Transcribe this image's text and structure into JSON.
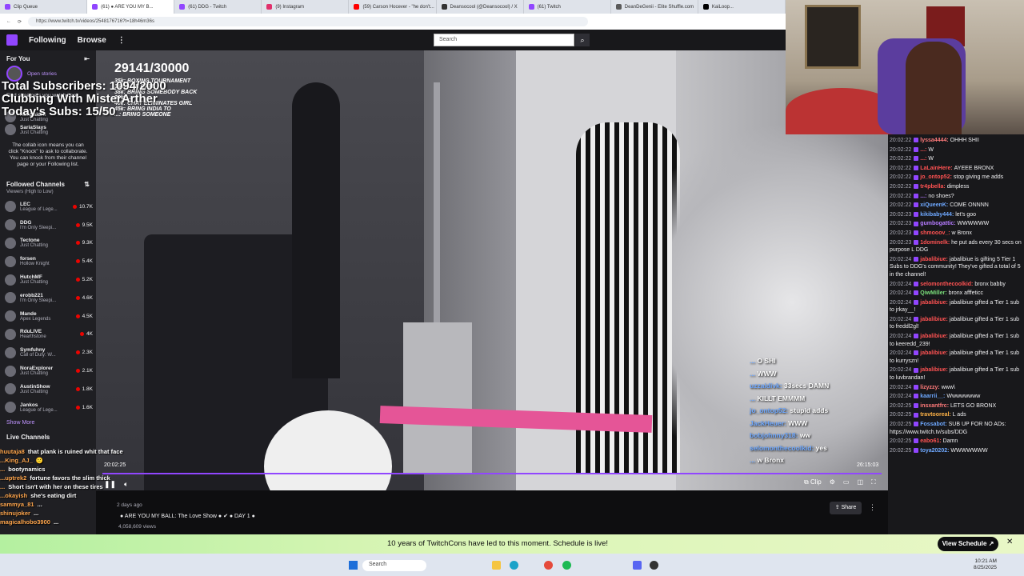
{
  "browser": {
    "tabs": [
      {
        "label": "Clip Queue",
        "color": "#9146ff"
      },
      {
        "label": "(61) ● ARE YOU MY B...",
        "color": "#9146ff"
      },
      {
        "label": "(61) DDG - Twitch",
        "color": "#9146ff"
      },
      {
        "label": "(9) Instagram",
        "color": "#e1306c"
      },
      {
        "label": "(59) Carson Hocever - \"he don't...",
        "color": "#ff0000"
      },
      {
        "label": "Deansocool (@Deansocool) / X",
        "color": "#333333"
      },
      {
        "label": "(61) Twitch",
        "color": "#9146ff"
      },
      {
        "label": "DeanDeGenii - Elite Shuffle.com",
        "color": "#5a5a5a"
      },
      {
        "label": "KaiLoop...",
        "color": "#000000"
      }
    ],
    "url": "https://www.twitch.tv/videos/2548176716?t=18h46m36s"
  },
  "nav": {
    "following": "Following",
    "browse": "Browse",
    "more": "⋮",
    "search_placeholder": "Search"
  },
  "sidebar": {
    "for_you": "For You",
    "open_stories": "Open stories",
    "find_streamers": "Find streamers you watch here",
    "suggested": [
      {
        "name": "AshSaidHi",
        "game": "Just Chatting"
      },
      {
        "name": "SariaSlays",
        "game": "Just Chatting"
      }
    ],
    "collab_tip": "The collab icon means you can click \"Knock\" to ask to collaborate. You can knock from their channel page or your Following list.",
    "followed_header": "Followed Channels",
    "followed_sub": "Viewers (High to Low)",
    "channels": [
      {
        "name": "LEC",
        "game": "League of Lege...",
        "viewers": "10.7K"
      },
      {
        "name": "DDG",
        "game": "I'm Only Sleepi...",
        "viewers": "9.5K"
      },
      {
        "name": "Tectone",
        "game": "Just Chatting",
        "viewers": "9.3K"
      },
      {
        "name": "forsen",
        "game": "Hollow Knight",
        "viewers": "5.4K"
      },
      {
        "name": "HutchMF",
        "game": "Just Chatting",
        "viewers": "5.2K"
      },
      {
        "name": "erobb221",
        "game": "I'm Only Sleepi...",
        "viewers": "4.6K"
      },
      {
        "name": "Mande",
        "game": "Apex Legends",
        "viewers": "4.5K"
      },
      {
        "name": "RduLIVE",
        "game": "Hearthstone",
        "viewers": "4K"
      },
      {
        "name": "Symfuhny",
        "game": "Call of Duty: W...",
        "viewers": "2.3K"
      },
      {
        "name": "NoraExplorer",
        "game": "Just Chatting",
        "viewers": "2.1K"
      },
      {
        "name": "AustinShow",
        "game": "Just Chatting",
        "viewers": "1.8K"
      },
      {
        "name": "Jankos",
        "game": "League of Lege...",
        "viewers": "1.6K"
      }
    ],
    "show_more": "Show More",
    "live_channels": "Live Channels"
  },
  "video": {
    "counter": "29141/30000",
    "goals": [
      "35k: BOXING TOURNAMENT",
      "36k: ...TE DATE",
      "38k: BRING SOMEBODY BACK",
      "39k: ...",
      "40k: CHAT ELIMINATES GIRL",
      "45k: BRING INDIA TO",
      "...: BRING SOMEONE"
    ],
    "subs_lines": [
      "Total Subscribers: 1094/2000",
      "Clubbing With MisterArther",
      "Today's Subs: 15/50"
    ],
    "current_time": "20:02:25",
    "duration": "26:15:03",
    "clip_label": "Clip",
    "share_label": "Share",
    "title": "● ARE YOU MY BALL: The Love Show ● ✔ ● DAY 1 ●",
    "age": "2 days ago",
    "views": "4,058,609 views",
    "chat_overlay": [
      {
        "user": "...",
        "text": "O SHI"
      },
      {
        "user": "...",
        "text": "WWW"
      },
      {
        "user": "uzzaidivk:",
        "text": "33secs DAMN"
      },
      {
        "user": "...",
        "text": "KILLT EMMMM"
      },
      {
        "user": "jo_ontop52:",
        "text": "stupid adds"
      },
      {
        "user": "JackHeuer:",
        "text": "WWW"
      },
      {
        "user": "bobjohnny318:",
        "text": "ww"
      },
      {
        "user": "selomonthecoolkid:",
        "text": "yes"
      },
      {
        "user": "...",
        "text": "w Bronx"
      }
    ]
  },
  "overlay_left_chat": [
    {
      "user": "huutaja8",
      "text": "that plank is ruined whit that face"
    },
    {
      "user": "...King_AJ_",
      "text": "🙁"
    },
    {
      "user": "...",
      "text": "bootynamics"
    },
    {
      "user": "...uptrek2",
      "text": "fortune favors the slim thick"
    },
    {
      "user": "...",
      "text": "Short isn't with her on these tires"
    },
    {
      "user": "...okayish",
      "text": "she's eating dirt"
    },
    {
      "user": "sammya_81",
      "text": "..."
    },
    {
      "user": "shinujoker",
      "text": "..."
    },
    {
      "user": "magicalhobo3900",
      "text": "..."
    }
  ],
  "chat": [
    {
      "time": "20:02:22",
      "user": "lyssa4444:",
      "text": "OHHH SHII",
      "color": "#ff7a7a"
    },
    {
      "time": "20:02:22",
      "user": "...:",
      "text": "W",
      "color": "#ff5252"
    },
    {
      "time": "20:02:22",
      "user": "...:",
      "text": "W",
      "color": "#ff5252"
    },
    {
      "time": "20:02:22",
      "user": "LaLainHere:",
      "text": "AYEEE BRONX",
      "color": "#ff5252"
    },
    {
      "time": "20:02:22",
      "user": "jo_ontop52:",
      "text": "stop giving me adds",
      "color": "#ff5252"
    },
    {
      "time": "20:02:22",
      "user": "tr4pbella:",
      "text": "dimpless",
      "color": "#ff5252"
    },
    {
      "time": "20:02:22",
      "user": "...:",
      "text": "no shoes?",
      "color": "#b57bff"
    },
    {
      "time": "20:02:22",
      "user": "xiQueenK:",
      "text": "COME ONNNN",
      "color": "#6ea8ff"
    },
    {
      "time": "20:02:23",
      "user": "kikibaby444:",
      "text": "let's goo",
      "color": "#6ea8ff"
    },
    {
      "time": "20:02:23",
      "user": "gumbogattic:",
      "text": "WWWWWW",
      "color": "#b57bff"
    },
    {
      "time": "20:02:23",
      "user": "shmooov_:",
      "text": "w Bronx",
      "color": "#ff5252"
    },
    {
      "time": "20:02:23",
      "user": "1dominelk:",
      "text": "he put ads every 30 secs on purpose L DDG",
      "color": "#ff5252"
    },
    {
      "time": "20:02:24",
      "user": "jabalibiue:",
      "text": "jabalibiue is gifting 5 Tier 1 Subs to DDG's community! They've gifted a total of 5 in the channel!",
      "color": "#ff5252"
    },
    {
      "time": "20:02:24",
      "user": "selomonthecoolkid:",
      "text": "bronx babby",
      "color": "#ff5252"
    },
    {
      "time": "20:02:24",
      "user": "QiwMiller:",
      "text": "bronx afffeticc",
      "color": "#7bdf7b"
    },
    {
      "time": "20:02:24",
      "user": "jabalibiue:",
      "text": "jabalibiue gifted a Tier 1 sub to jrkay__!",
      "color": "#ff5252"
    },
    {
      "time": "20:02:24",
      "user": "jabalibiue:",
      "text": "jabalibiue gifted a Tier 1 sub to freddl2gl!",
      "color": "#ff5252"
    },
    {
      "time": "20:02:24",
      "user": "jabalibiue:",
      "text": "jabalibiue gifted a Tier 1 sub to keeredd_239!",
      "color": "#ff5252"
    },
    {
      "time": "20:02:24",
      "user": "jabalibiue:",
      "text": "jabalibiue gifted a Tier 1 sub to kurryszn!",
      "color": "#ff5252"
    },
    {
      "time": "20:02:24",
      "user": "jabalibiue:",
      "text": "jabalibiue gifted a Tier 1 sub to luvbrandan!",
      "color": "#ff5252"
    },
    {
      "time": "20:02:24",
      "user": "lizyzzy:",
      "text": "www\\",
      "color": "#ff7a7a"
    },
    {
      "time": "20:02:24",
      "user": "kaarrii__:",
      "text": "Wwwwwwww",
      "color": "#6ea8ff"
    },
    {
      "time": "20:02:25",
      "user": "insxantfrc:",
      "text": "LETS GO BRONX",
      "color": "#ff7a7a"
    },
    {
      "time": "20:02:25",
      "user": "travtooreal:",
      "text": "L ads",
      "color": "#ffb347"
    },
    {
      "time": "20:02:25",
      "user": "Fossabot:",
      "text": "SUB UP FOR NO ADs: https://www.twitch.tv/subs/DDG",
      "color": "#6ea8ff"
    },
    {
      "time": "20:02:25",
      "user": "eabo61:",
      "text": "Damn",
      "color": "#ff5252"
    },
    {
      "time": "20:02:25",
      "user": "toya20202:",
      "text": "WWWWWWW",
      "color": "#6ea8ff"
    }
  ],
  "banner": {
    "text": "10 years of TwitchCons have led to this moment. Schedule is live!",
    "button": "View Schedule ↗",
    "close": "✕"
  },
  "taskbar": {
    "search": "Search",
    "time": "10:21 AM",
    "date": "8/25/2025"
  },
  "colors": {
    "accent": "#9146ff",
    "bg": "#0e0e10",
    "banner": "#c8f2a8"
  }
}
